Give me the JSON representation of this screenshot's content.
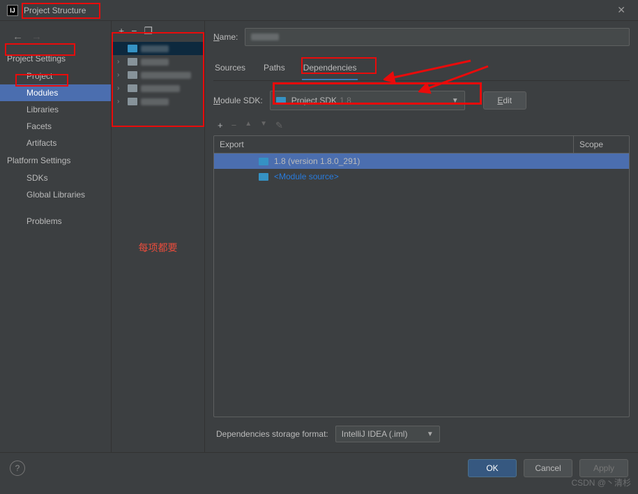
{
  "window": {
    "title": "Project Structure"
  },
  "sidebar": {
    "back_icon": "←",
    "forward_icon": "→",
    "project_settings_header": "Project Settings",
    "platform_settings_header": "Platform Settings",
    "items": {
      "project": "Project",
      "modules": "Modules",
      "libraries": "Libraries",
      "facets": "Facets",
      "artifacts": "Artifacts",
      "sdks": "SDKs",
      "global_libraries": "Global Libraries",
      "problems": "Problems"
    }
  },
  "module_panel": {
    "toolbar": {
      "add": "+",
      "remove": "−",
      "copy": "❐"
    },
    "note": "每项都要"
  },
  "content": {
    "name_label": "Name:",
    "tabs": {
      "sources": "Sources",
      "paths": "Paths",
      "dependencies": "Dependencies"
    },
    "sdk_label": "Module SDK:",
    "sdk_select": {
      "name": "Project SDK",
      "version": "1.8"
    },
    "edit_btn": "Edit",
    "dep_toolbar": {
      "add": "+",
      "remove": "−",
      "up": "▲",
      "down": "▼",
      "edit": "✎"
    },
    "dep_table": {
      "h_export": "Export",
      "h_scope": "Scope",
      "row1": "1.8 (version 1.8.0_291)",
      "row2": "<Module source>"
    },
    "storage_label": "Dependencies storage format:",
    "storage_value": "IntelliJ IDEA (.iml)"
  },
  "footer": {
    "help": "?",
    "ok": "OK",
    "cancel": "Cancel",
    "apply": "Apply"
  },
  "watermark": "CSDN @丶清杉"
}
